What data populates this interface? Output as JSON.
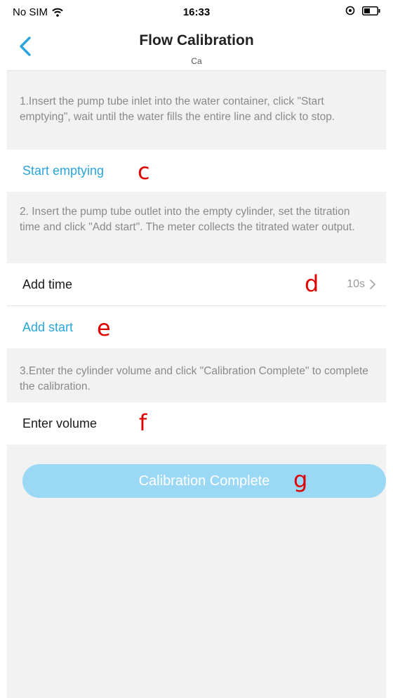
{
  "status_bar": {
    "carrier": "No SIM",
    "time": "16:33"
  },
  "header": {
    "title": "Flow Calibration",
    "subtitle": "Ca"
  },
  "steps": {
    "step1_text": "1.Insert the pump tube inlet into the water container, click \"Start emptying\", wait until the water fills the entire line and click to stop.",
    "start_emptying_label": "Start emptying",
    "step2_text": "2. Insert the pump tube outlet into the empty cylinder, set the titration time and click \"Add start\". The meter collects the titrated water output.",
    "add_time_label": "Add time",
    "add_time_value": "10s",
    "add_start_label": "Add start",
    "step3_text": "3.Enter the cylinder volume and click \"Calibration Complete\" to complete the calibration.",
    "enter_volume_label": "Enter volume"
  },
  "footer": {
    "complete_button_label": "Calibration Complete"
  },
  "annotations": {
    "c": "c",
    "d": "d",
    "e": "e",
    "f": "f",
    "g": "g"
  },
  "colors": {
    "accent": "#2aa5dc",
    "button_bg": "#9bd8f6",
    "marker": "#e00000",
    "background": "#f2f2f2"
  }
}
